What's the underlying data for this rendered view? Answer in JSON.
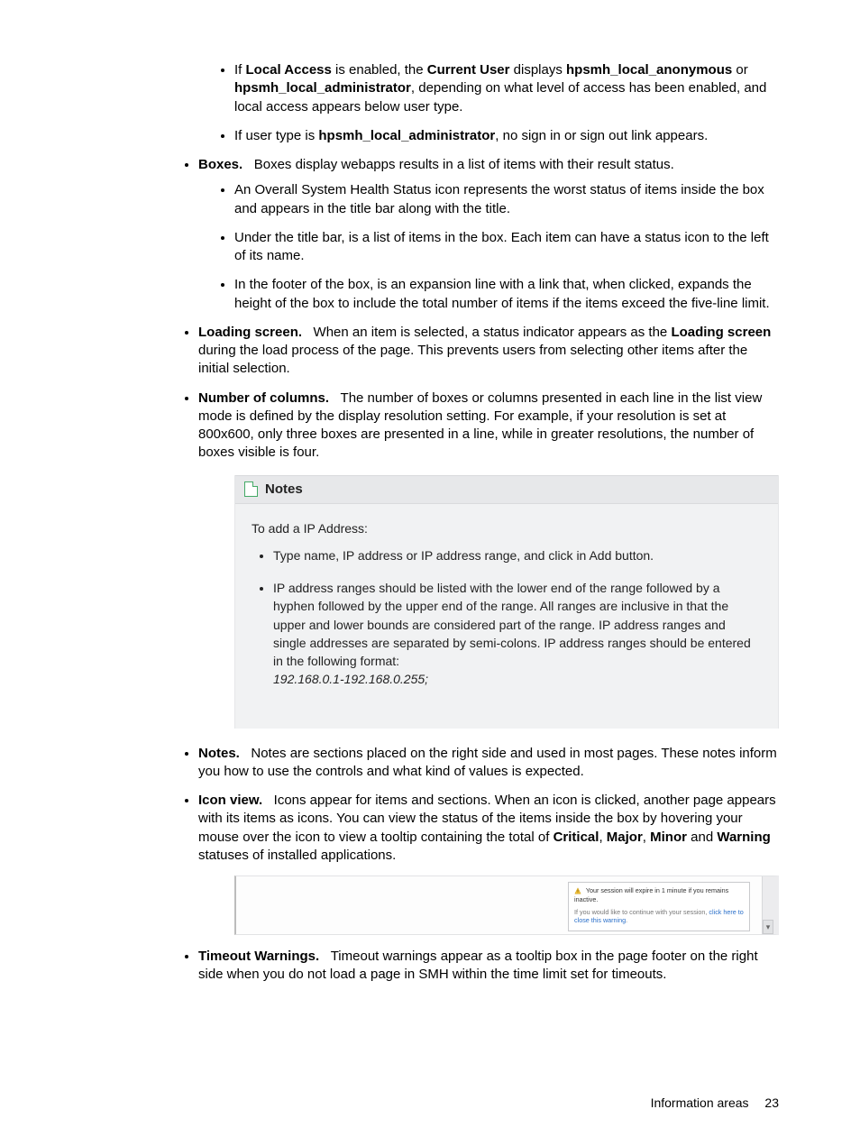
{
  "bullets_top_sub": [
    {
      "pre": "If ",
      "b1": "Local Access",
      "mid": " is enabled, the ",
      "b2": "Current User",
      "mid2": " displays ",
      "b3": "hpsmh_local_anonymous",
      "mid3": " or ",
      "b4": "hpsmh_local_administrator",
      "post": ", depending on what level of access has been enabled, and local access appears below user type."
    },
    {
      "pre": "If user type is ",
      "b1": "hpsmh_local_administrator",
      "post": ", no sign in or sign out link appears."
    }
  ],
  "boxes": {
    "label": "Boxes.",
    "text": "Boxes display webapps results in a list of items with their result status.",
    "subs": [
      "An Overall System Health Status icon represents the worst status of items inside the box and appears in the title bar along with the title.",
      "Under the title bar, is a list of items in the box. Each item can have a status icon to the left of its name.",
      "In the footer of the box, is an expansion line with a link that, when clicked, expands the height of the box to include the total number of items if the items exceed the five-line limit."
    ]
  },
  "loading": {
    "label": "Loading screen.",
    "pre": "When an item is selected, a status indicator appears as the ",
    "bold": "Loading screen",
    "post": " during the load process of the page. This prevents users from selecting other items after the initial selection."
  },
  "columns": {
    "label": "Number of columns.",
    "text": "The number of boxes or columns presented in each line in the list view mode is defined by the display resolution setting. For example, if your resolution is set at 800x600, only three boxes are presented in a line, while in greater resolutions, the number of boxes visible is four."
  },
  "notesbox": {
    "title": "Notes",
    "intro": "To add a IP Address:",
    "items": [
      "Type name, IP address or IP address range, and click in Add button.",
      "IP address ranges should be listed with the lower end of the range followed by a hyphen followed by the upper end of the range. All ranges are inclusive in that the upper and lower bounds are considered part of the range. IP address ranges and single addresses are separated by semi-colons. IP address ranges should be entered in the following format:"
    ],
    "example": "192.168.0.1-192.168.0.255;"
  },
  "notes": {
    "label": "Notes.",
    "text": "Notes are sections placed on the right side and used in most pages. These notes inform you how to use the controls and what kind of values is expected."
  },
  "iconview": {
    "label": "Icon view.",
    "pre": "Icons appear for items and sections. When an icon is clicked, another page appears with its items as icons. You can view the status of the items inside the box by hovering your mouse over the icon to view a tooltip containing the total of ",
    "b1": "Critical",
    "c1": ", ",
    "b2": "Major",
    "c2": ", ",
    "b3": "Minor",
    "c3": " and ",
    "b4": "Warning",
    "post": " statuses of installed applications."
  },
  "timeout_tip": {
    "warn": "Your session will expire in 1 minute if you remains inactive.",
    "line_pre": "If you would like to continue with your session, ",
    "link": "click here to close this warning",
    "line_post": "."
  },
  "timeout": {
    "label": "Timeout Warnings.",
    "text": "Timeout warnings appear as a tooltip box in the page footer on the right side when you do not load a page in SMH within the time limit set for timeouts."
  },
  "footer": {
    "section": "Information areas",
    "page": "23"
  }
}
